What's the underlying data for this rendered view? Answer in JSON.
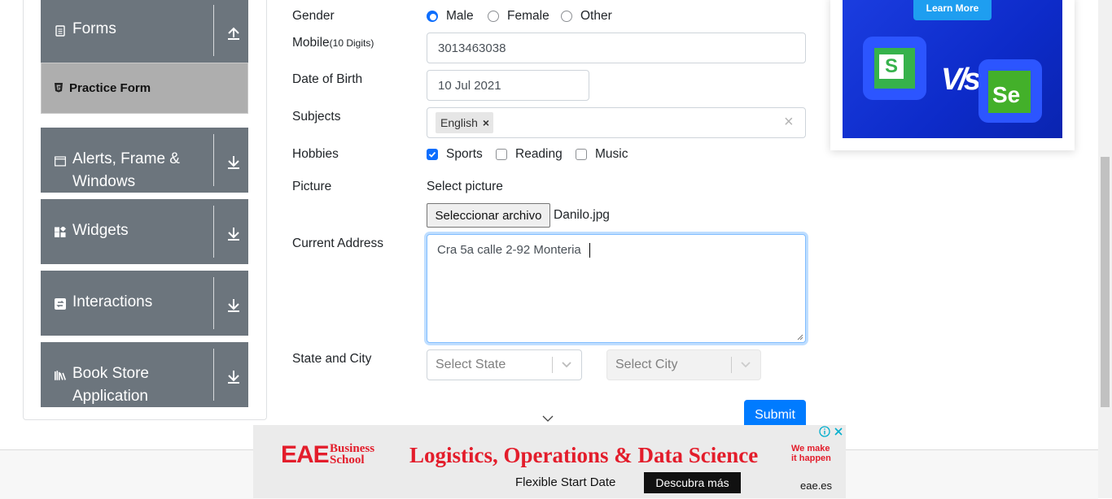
{
  "sidebar": {
    "groups": [
      {
        "title": "Forms"
      },
      {
        "title": "Alerts, Frame &",
        "title2": "Windows"
      },
      {
        "title": "Widgets"
      },
      {
        "title": "Interactions"
      },
      {
        "title": "Book Store",
        "title2": "Application"
      }
    ],
    "active_item": "Practice Form"
  },
  "form": {
    "gender": {
      "label": "Gender",
      "options": [
        "Male",
        "Female",
        "Other"
      ],
      "selected": "Male"
    },
    "mobile": {
      "label": "Mobile",
      "hint": "(10 Digits)",
      "value": "3013463038"
    },
    "dob": {
      "label": "Date of Birth",
      "value": "10 Jul 2021"
    },
    "subjects": {
      "label": "Subjects",
      "chips": [
        "English"
      ],
      "chip_remove": "×",
      "clear": "×"
    },
    "hobbies": {
      "label": "Hobbies",
      "options": [
        "Sports",
        "Reading",
        "Music"
      ],
      "checked": [
        "Sports"
      ]
    },
    "picture": {
      "label": "Picture",
      "caption": "Select picture",
      "button": "Seleccionar archivo",
      "filename": "Danilo.jpg"
    },
    "address": {
      "label": "Current Address",
      "value": "Cra 5a calle 2-92 Monteria"
    },
    "state_city": {
      "label": "State and City",
      "state_placeholder": "Select State",
      "city_placeholder": "Select City"
    },
    "submit": "Submit"
  },
  "top_ad": {
    "cta": "Learn More",
    "vs": "V/s",
    "logo1": "S",
    "logo2": "Se"
  },
  "bottom_ad": {
    "brand1": "EAE",
    "brand2": "Business",
    "brand3": "School",
    "headline": "Logistics, Operations & Data Science",
    "tag1": "We make",
    "tag2": "it happen",
    "subline": "Flexible Start Date",
    "cta": "Descubra más",
    "domain": "eae.es"
  },
  "colors": {
    "sidebar_group": "#6c757d",
    "primary": "#007bff",
    "ad_red": "#e31d2b"
  }
}
